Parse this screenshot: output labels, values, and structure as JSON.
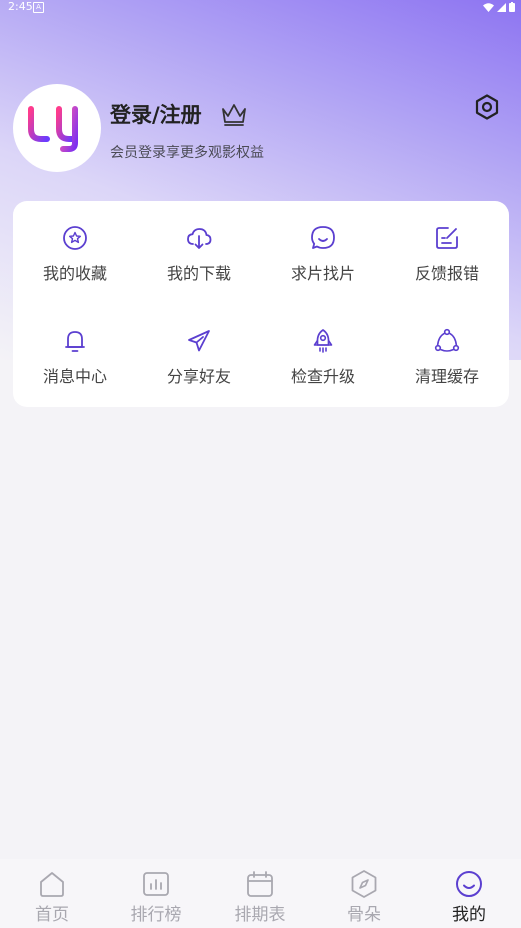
{
  "status_bar": {
    "time": "2:45",
    "notification_icon": "A"
  },
  "profile": {
    "title": "登录/注册",
    "subtitle": "会员登录享更多观影权益",
    "avatar_icon": "app-logo",
    "crown_icon": "crown-icon",
    "settings_icon": "settings-icon"
  },
  "menu": {
    "items": [
      {
        "label": "我的收藏",
        "icon": "favorite-star-icon"
      },
      {
        "label": "我的下载",
        "icon": "cloud-download-icon"
      },
      {
        "label": "求片找片",
        "icon": "chat-bubble-icon"
      },
      {
        "label": "反馈报错",
        "icon": "edit-note-icon"
      },
      {
        "label": "消息中心",
        "icon": "bell-icon"
      },
      {
        "label": "分享好友",
        "icon": "paper-plane-icon"
      },
      {
        "label": "检查升级",
        "icon": "rocket-icon"
      },
      {
        "label": "清理缓存",
        "icon": "recycle-icon"
      }
    ]
  },
  "tabbar": {
    "tabs": [
      {
        "label": "首页",
        "icon": "home-icon",
        "active": false
      },
      {
        "label": "排行榜",
        "icon": "chart-icon",
        "active": false
      },
      {
        "label": "排期表",
        "icon": "calendar-icon",
        "active": false
      },
      {
        "label": "骨朵",
        "icon": "compass-icon",
        "active": false
      },
      {
        "label": "我的",
        "icon": "smiley-icon",
        "active": true
      }
    ]
  },
  "colors": {
    "accent": "#5b3fd0",
    "inactive": "#a9a8b0",
    "hero_start": "#8d74f2"
  }
}
